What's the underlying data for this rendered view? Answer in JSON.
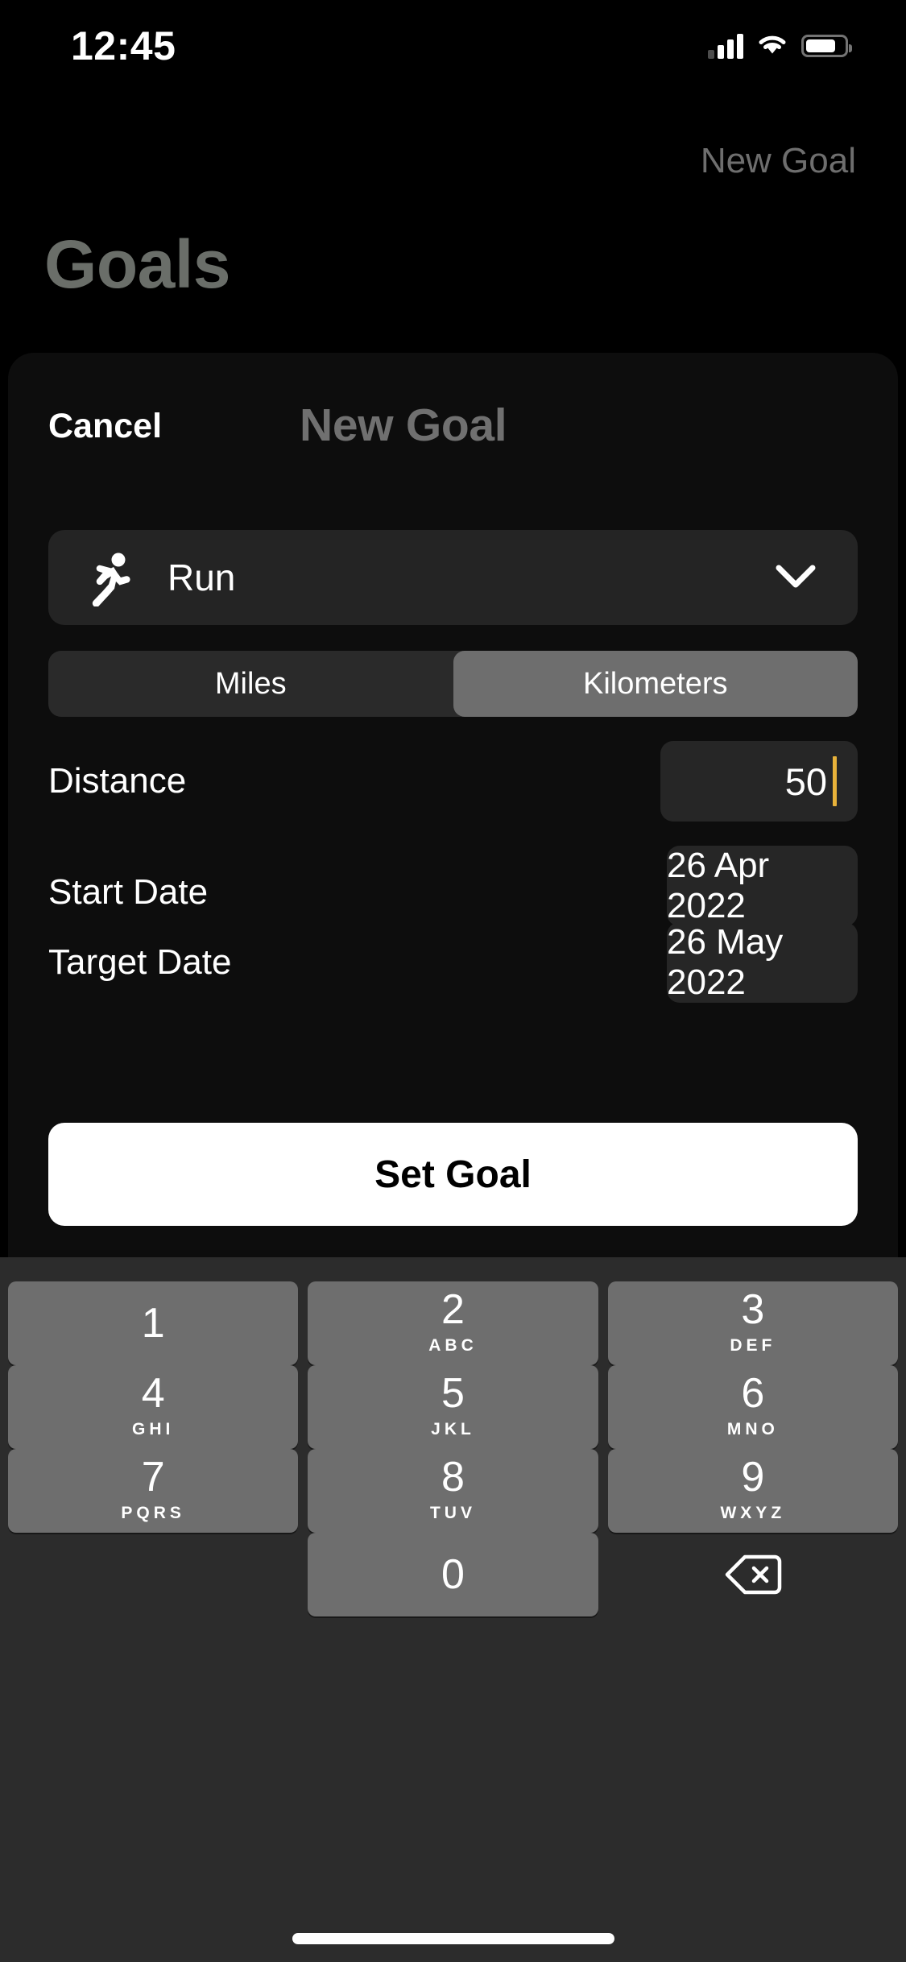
{
  "status_bar": {
    "time": "12:45",
    "cellular_icon": "cellular-signal-icon",
    "wifi_icon": "wifi-icon",
    "battery_icon": "battery-icon"
  },
  "background_page": {
    "title": "Goals",
    "new_goal_button": "New Goal"
  },
  "sheet": {
    "cancel_label": "Cancel",
    "title": "New Goal",
    "activity": {
      "label": "Run",
      "icon": "running-figure-icon",
      "chevron_icon": "chevron-down-icon"
    },
    "units": {
      "options": [
        "Miles",
        "Kilometers"
      ],
      "selected": "Kilometers"
    },
    "fields": {
      "distance": {
        "label": "Distance",
        "value": "50"
      },
      "start_date": {
        "label": "Start Date",
        "value": "26 Apr 2022"
      },
      "target_date": {
        "label": "Target Date",
        "value": "26 May 2022"
      }
    },
    "submit_label": "Set Goal"
  },
  "keyboard": {
    "type": "numeric-keypad",
    "keys": [
      {
        "digit": "1",
        "letters": ""
      },
      {
        "digit": "2",
        "letters": "ABC"
      },
      {
        "digit": "3",
        "letters": "DEF"
      },
      {
        "digit": "4",
        "letters": "GHI"
      },
      {
        "digit": "5",
        "letters": "JKL"
      },
      {
        "digit": "6",
        "letters": "MNO"
      },
      {
        "digit": "7",
        "letters": "PQRS"
      },
      {
        "digit": "8",
        "letters": "TUV"
      },
      {
        "digit": "9",
        "letters": "WXYZ"
      },
      {
        "digit": "0",
        "letters": ""
      }
    ],
    "delete_icon": "delete-backward-icon"
  },
  "colors": {
    "accent_caret": "#E8B23A",
    "sheet_background": "#0D0D0D",
    "card": "#242424",
    "segment_selected": "#6E6E6E",
    "keyboard_background": "#2C2C2C",
    "key": "#6E6E6E",
    "primary_button": "#FFFFFF"
  }
}
